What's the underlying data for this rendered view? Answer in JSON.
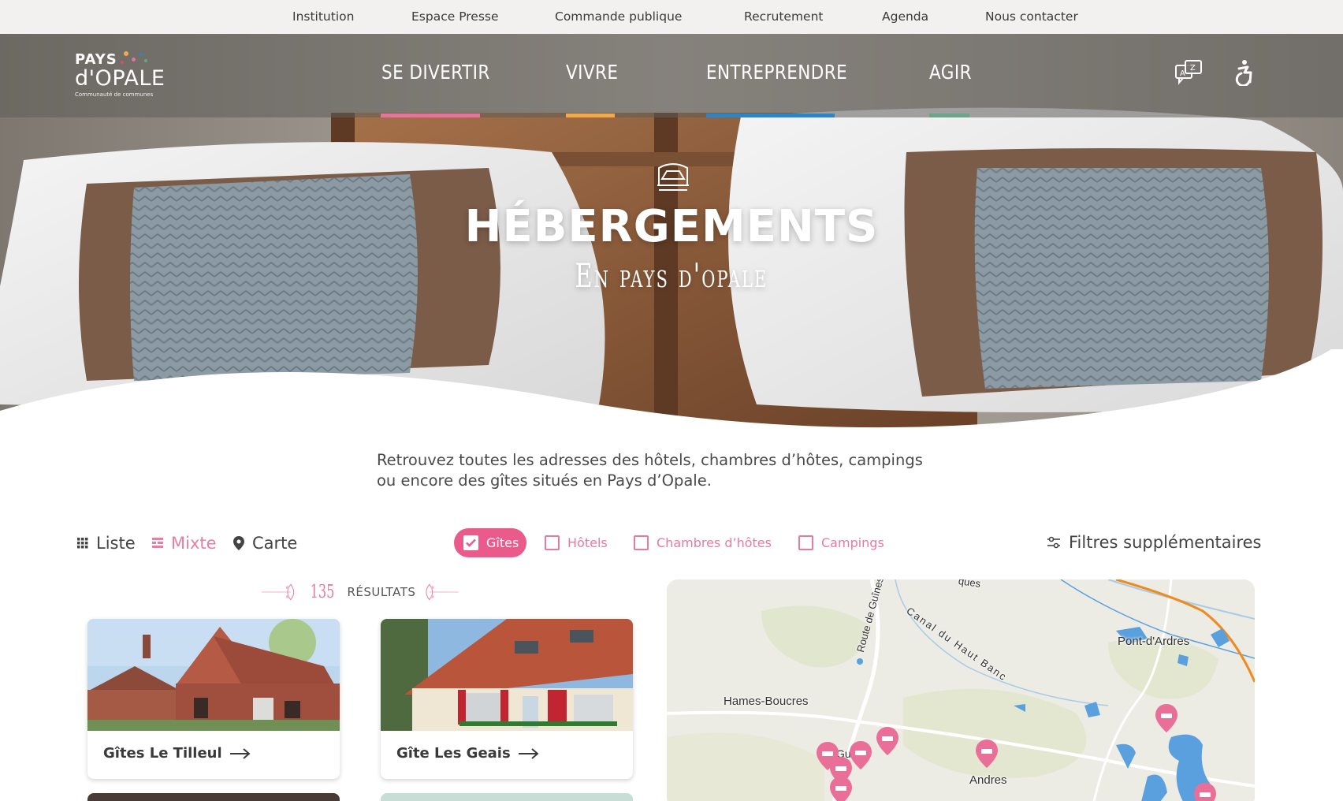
{
  "utility_nav": [
    "Institution",
    "Espace Presse",
    "Commande publique",
    "Recrutement",
    "Agenda",
    "Nous contacter"
  ],
  "logo": {
    "line1": "PAYS",
    "line2": "d'OPALE",
    "line3": "Communauté de communes"
  },
  "main_nav": [
    {
      "label": "SE DIVERTIR",
      "color": "#e7739c"
    },
    {
      "label": "VIVRE",
      "color": "#f3a948"
    },
    {
      "label": "ENTREPRENDRE",
      "color": "#2a86c6"
    },
    {
      "label": "AGIR",
      "color": "#6aa587"
    }
  ],
  "header_icons": [
    "translate-icon",
    "accessibility-icon"
  ],
  "hero": {
    "title": "HÉBERGEMENTS",
    "subtitle": "En pays d'opale",
    "icon": "bed-icon"
  },
  "intro": {
    "line1": "Retrouvez toutes les adresses des hôtels, chambres d’hôtes, campings",
    "line2": "ou encore des gîtes situés en Pays d’Opale."
  },
  "views": [
    {
      "label": "Liste",
      "icon": "grid-icon",
      "active": false
    },
    {
      "label": "Mixte",
      "icon": "mixed-view-icon",
      "active": true
    },
    {
      "label": "Carte",
      "icon": "map-pin-icon",
      "active": false
    }
  ],
  "filters": [
    {
      "label": "Gîtes",
      "checked": true
    },
    {
      "label": "Hôtels",
      "checked": false
    },
    {
      "label": "Chambres d’hôtes",
      "checked": false
    },
    {
      "label": "Campings",
      "checked": false
    }
  ],
  "more_filters": "Filtres supplémentaires",
  "results": {
    "count": "135",
    "label": "RÉSULTATS"
  },
  "cards": [
    {
      "title": "Gîtes Le Tilleul"
    },
    {
      "title": "Gîte Les Geais"
    }
  ],
  "map": {
    "labels": [
      "Hames-Boucres",
      "Pont-d'Ardres",
      "Andres",
      "Route de Guînes",
      "Canal du Haut Banc",
      "Gu",
      "s",
      "ques"
    ]
  },
  "colors": {
    "accent": "#ea5a8a",
    "accent_light": "#e77aa0"
  }
}
